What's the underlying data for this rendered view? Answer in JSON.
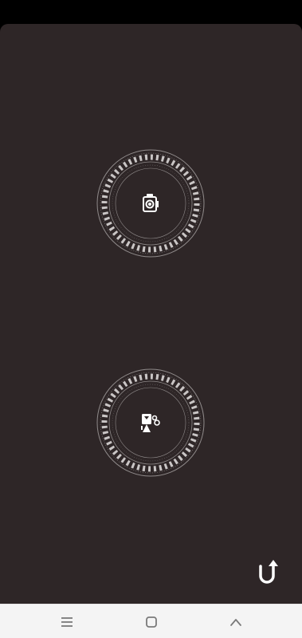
{
  "colors": {
    "panel_background": "#2e2627",
    "dial_ring": "#8f8a8a",
    "dial_chevrons": "#c9c5c5",
    "icon": "#ffffff",
    "nav_background": "#f4f4f4",
    "nav_icon": "#7a7a7a"
  },
  "dials": [
    {
      "mode": "photo",
      "icon": "camera-icon",
      "ring_text": ""
    },
    {
      "mode": "video",
      "icon": "video-camera-icon",
      "ring_text": ""
    }
  ],
  "controls": {
    "return_icon": "u-turn-arrow-icon"
  },
  "nav_bar": {
    "buttons": [
      "menu-icon",
      "home-square-icon",
      "back-chevron-icon"
    ]
  }
}
